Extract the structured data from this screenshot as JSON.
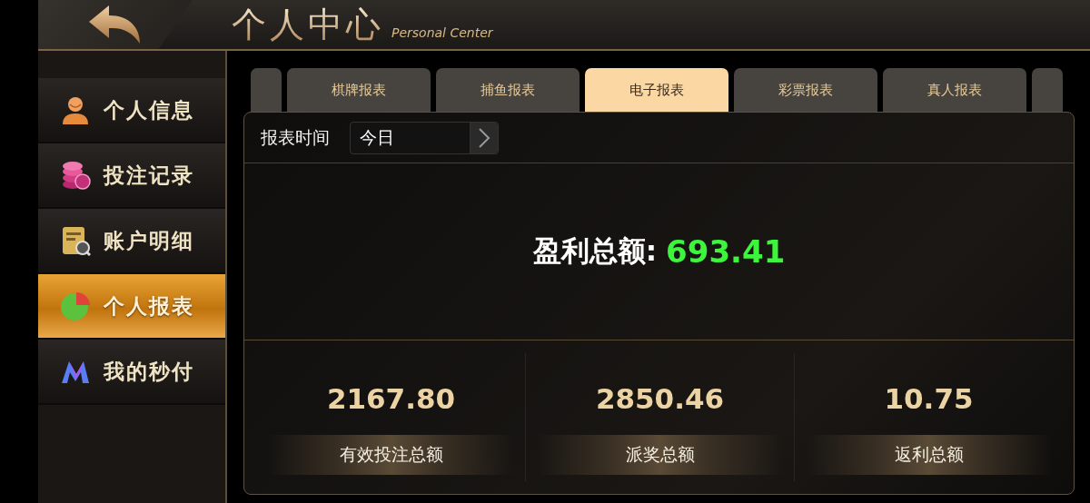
{
  "header": {
    "title": "个人中心",
    "subtitle": "Personal Center"
  },
  "sidebar": {
    "items": [
      {
        "label": "个人信息",
        "kind": "person",
        "selected": false
      },
      {
        "label": "投注记录",
        "kind": "coins",
        "selected": false
      },
      {
        "label": "账户明细",
        "kind": "ledger",
        "selected": false
      },
      {
        "label": "个人报表",
        "kind": "pie",
        "selected": true
      },
      {
        "label": "我的秒付",
        "kind": "logo",
        "selected": false
      }
    ]
  },
  "tabs": [
    {
      "label": "棋牌报表",
      "selected": false
    },
    {
      "label": "捕鱼报表",
      "selected": false
    },
    {
      "label": "电子报表",
      "selected": true
    },
    {
      "label": "彩票报表",
      "selected": false
    },
    {
      "label": "真人报表",
      "selected": false
    }
  ],
  "filter": {
    "label": "报表时间",
    "value": "今日"
  },
  "profit": {
    "label": "盈利总额:",
    "value": "693.41"
  },
  "stats": [
    {
      "value": "2167.80",
      "label": "有效投注总额"
    },
    {
      "value": "2850.46",
      "label": "派奖总额"
    },
    {
      "value": "10.75",
      "label": "返利总额"
    }
  ]
}
